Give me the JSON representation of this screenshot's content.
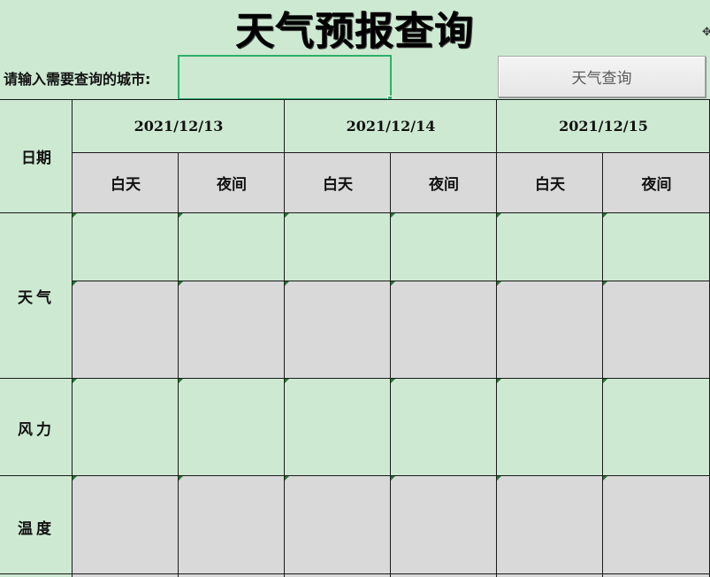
{
  "title": "天气预报查询",
  "prompt_label": "请输入需要查询的城市:",
  "city_input": {
    "value": "",
    "placeholder": ""
  },
  "query_button_label": "天气查询",
  "table": {
    "date_header": "日期",
    "dates": [
      "2021/12/13",
      "2021/12/14",
      "2021/12/15"
    ],
    "periods": [
      "白天",
      "夜间"
    ],
    "rows": {
      "weather": "天气",
      "wind": "风力",
      "temperature": "温度"
    }
  },
  "colors": {
    "green_fill": "#cde9d2",
    "gray_fill": "#d9d9d9",
    "active_border": "#2fae6a"
  }
}
